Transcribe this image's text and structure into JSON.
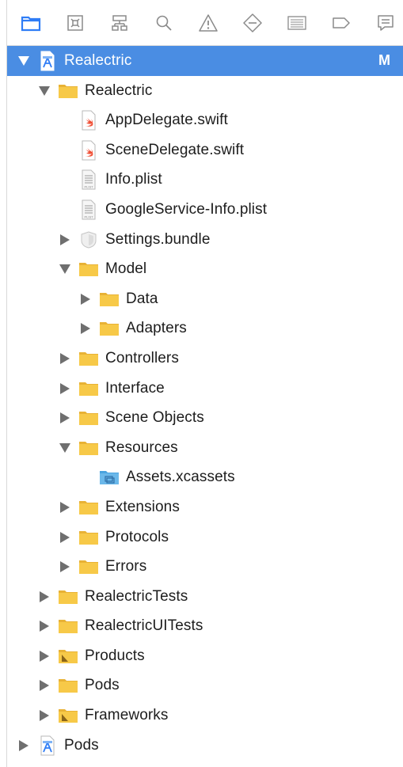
{
  "toolbar": {
    "icons": [
      {
        "name": "project-navigator-icon",
        "active": true
      },
      {
        "name": "source-control-icon",
        "active": false
      },
      {
        "name": "symbol-navigator-icon",
        "active": false
      },
      {
        "name": "find-icon",
        "active": false
      },
      {
        "name": "issue-warning-icon",
        "active": false
      },
      {
        "name": "test-navigator-icon",
        "active": false
      },
      {
        "name": "debug-navigator-icon",
        "active": false
      },
      {
        "name": "breakpoint-icon",
        "active": false
      },
      {
        "name": "report-icon",
        "active": false
      }
    ]
  },
  "colors": {
    "selection": "#4a8de3",
    "folder": "#f7c948",
    "folder_dark": "#e8b235",
    "swift": "#f05138",
    "accent": "#2f7df6"
  },
  "tree": [
    {
      "label": "Realectric",
      "badge": "M",
      "icon": "xcode-project-icon",
      "expanded": true,
      "selected": true
    },
    {
      "label": "Realectric",
      "icon": "folder-icon",
      "expanded": true
    },
    {
      "label": "AppDelegate.swift",
      "icon": "swift-file-icon"
    },
    {
      "label": "SceneDelegate.swift",
      "icon": "swift-file-icon"
    },
    {
      "label": "Info.plist",
      "icon": "plist-file-icon"
    },
    {
      "label": "GoogleService-Info.plist",
      "icon": "plist-file-icon"
    },
    {
      "label": "Settings.bundle",
      "icon": "bundle-icon",
      "expanded": false
    },
    {
      "label": "Model",
      "icon": "folder-icon",
      "expanded": true
    },
    {
      "label": "Data",
      "icon": "folder-icon",
      "expanded": false
    },
    {
      "label": "Adapters",
      "icon": "folder-icon",
      "expanded": false
    },
    {
      "label": "Controllers",
      "icon": "folder-icon",
      "expanded": false
    },
    {
      "label": "Interface",
      "icon": "folder-icon",
      "expanded": false
    },
    {
      "label": "Scene Objects",
      "icon": "folder-icon",
      "expanded": false
    },
    {
      "label": "Resources",
      "icon": "folder-icon",
      "expanded": true
    },
    {
      "label": "Assets.xcassets",
      "icon": "asset-catalog-icon"
    },
    {
      "label": "Extensions",
      "icon": "folder-icon",
      "expanded": false
    },
    {
      "label": "Protocols",
      "icon": "folder-icon",
      "expanded": false
    },
    {
      "label": "Errors",
      "icon": "folder-icon",
      "expanded": false
    },
    {
      "label": "RealectricTests",
      "icon": "folder-icon",
      "expanded": false
    },
    {
      "label": "RealectricUITests",
      "icon": "folder-icon",
      "expanded": false
    },
    {
      "label": "Products",
      "icon": "products-folder-icon",
      "expanded": false
    },
    {
      "label": "Pods",
      "icon": "folder-icon",
      "expanded": false
    },
    {
      "label": "Frameworks",
      "icon": "products-folder-icon",
      "expanded": false
    },
    {
      "label": "Pods",
      "icon": "xcode-project-icon",
      "expanded": false
    }
  ]
}
